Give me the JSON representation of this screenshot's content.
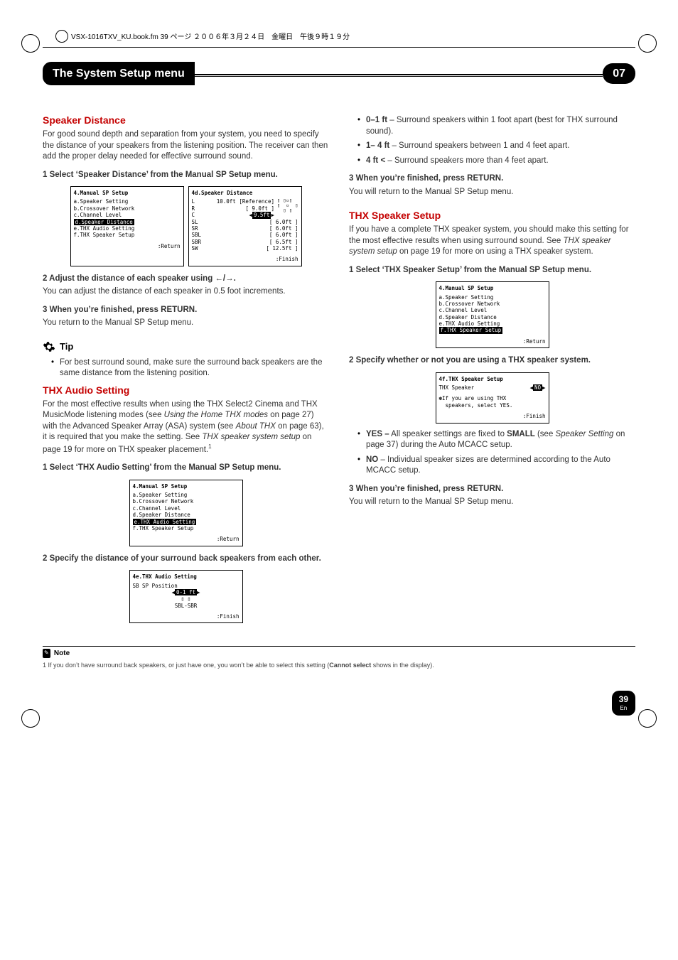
{
  "book_header": "VSX-1016TXV_KU.book.fm 39 ページ ２００６年３月２４日　金曜日　午後９時１９分",
  "title_bar": {
    "left": "The System Setup menu",
    "right": "07"
  },
  "left": {
    "sd": {
      "head": "Speaker Distance",
      "p1": "For good sound depth and separation from your system, you need to specify the distance of your speakers from the listening position. The receiver can then add the proper delay needed for effective surround sound.",
      "s1a": "1   Select ‘Speaker Distance’ from the Manual SP Setup menu.",
      "s2a": "2   Adjust the distance of each speaker using  ←/→.",
      "s2b": "You can adjust the distance of each speaker in 0.5 foot increments.",
      "s3a": "3   When you’re finished, press RETURN.",
      "s3b": "You return to the Manual SP Setup menu."
    },
    "tip": {
      "label": "Tip",
      "li1a": "For best surround sound, make sure the surround back speakers are the same distance from the listening position."
    },
    "thx": {
      "head": "THX Audio Setting",
      "p1a": "For the most effective results when using the THX Select2 Cinema and THX MusicMode listening modes (see ",
      "p1i1": "Using the Home THX modes",
      "p1b": " on page 27) with the Advanced Speaker Array (ASA) system (see ",
      "p1i2": "About THX",
      "p1c": " on page 63), it is required that you make the setting. See ",
      "p1i3": "THX speaker system setup",
      "p1d": " on page 19 for more on THX speaker placement.",
      "sup": "1",
      "s1a": "1   Select ‘THX Audio Setting’ from the Manual SP Setup menu.",
      "s2a": "2   Specify the distance of your surround back speakers from each other."
    },
    "osd1": {
      "title": "4.Manual SP Setup",
      "a": "a.Speaker Setting",
      "b": "b.Crossover Network",
      "c": "c.Channel Level",
      "d": "d.Speaker Distance",
      "e": "e.THX Audio Setting",
      "f": "f.THX Speaker Setup",
      "ret": ":Return"
    },
    "osd2": {
      "title": "4d.Speaker Distance",
      "l": "L",
      "lv": "10.0ft",
      "ref": "[Reference]",
      "r": "R",
      "rv": "[   9.0ft ]",
      "c": "C",
      "cv": "9.5ft",
      "sl": "SL",
      "slv": "[   6.0ft ]",
      "sr": "SR",
      "srv": "[   6.0ft ]",
      "sbl": "SBL",
      "sblv": "[   6.0ft ]",
      "sbr": "SBR",
      "sbrv": "[   6.5ft ]",
      "sw": "SW",
      "swv": "[ 12.5ft ]",
      "fin": ":Finish"
    },
    "osd3": {
      "title": "4.Manual SP Setup",
      "a": "a.Speaker Setting",
      "b": "b.Crossover Network",
      "c": "c.Channel Level",
      "d": "d.Speaker Distance",
      "e": "e.THX Audio Setting",
      "f": "f.THX Speaker Setup",
      "ret": ":Return"
    },
    "osd4": {
      "title": "4e.THX Audio Setting",
      "row1": "SB SP Position",
      "row2": "0-1 ft",
      "row3": "▯ ▯",
      "row4": "SBL-SBR",
      "fin": ":Finish"
    }
  },
  "right": {
    "bul": {
      "li1a": "0–1 ft",
      "li1b": " – Surround speakers within 1 foot apart (best for THX surround sound).",
      "li2a": "1– 4 ft",
      "li2b": " – Surround speakers between 1 and 4 feet apart.",
      "li3a": "4 ft <",
      "li3b": " – Surround speakers more than 4 feet apart."
    },
    "s3a": "3   When you’re finished, press RETURN.",
    "s3b": "You will return to the Manual SP Setup menu.",
    "tss": {
      "head": "THX Speaker Setup",
      "p1a": "If you have a complete THX speaker system, you should make this setting for the most effective results when using surround sound. See ",
      "p1i": "THX speaker system setup",
      "p1b": " on page 19 for more on using a THX speaker system.",
      "s1a": "1   Select ‘THX Speaker Setup’ from the Manual SP Setup menu.",
      "s2a": "2   Specify whether or not you are using a THX speaker system."
    },
    "bul2": {
      "li1a": "YES –",
      "li1b": " All speaker settings are fixed to ",
      "li1c": "SMALL",
      "li1d": " (see ",
      "li1i": "Speaker Setting",
      "li1e": " on page 37) during the Auto MCACC setup.",
      "li2a": "NO",
      "li2b": " – Individual speaker sizes are determined according to the Auto MCACC setup."
    },
    "s3c": "3   When you’re finished, press RETURN.",
    "s3d": "You will return to the Manual SP Setup menu.",
    "osd5": {
      "title": "4.Manual SP Setup",
      "a": "a.Speaker Setting",
      "b": "b.Crossover Network",
      "c": "c.Channel Level",
      "d": "d.Speaker Distance",
      "e": "e.THX Audio Setting",
      "f": "f.THX Speaker Setup",
      "ret": ":Return"
    },
    "osd6": {
      "title": "4f.THX Speaker Setup",
      "row1a": "THX Speaker",
      "row1b": "NO",
      "row2": "If you are using THX",
      "row3": "speakers, select YES.",
      "fin": ":Finish"
    }
  },
  "note": {
    "label": "Note",
    "text1": "1 If you don’t have surround back speakers, or just have one, you won’t be able to select this setting (",
    "text2": "Cannot select",
    "text3": " shows in the display)."
  },
  "footer": {
    "page": "39",
    "lang": "En"
  }
}
